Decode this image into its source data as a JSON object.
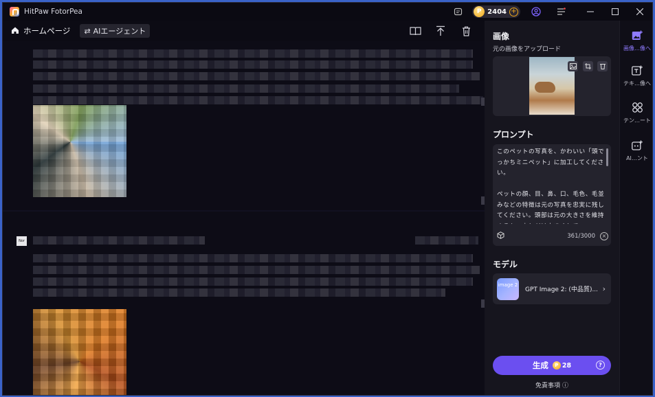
{
  "app": {
    "title": "HitPaw FotorPea",
    "coins": "2404"
  },
  "toolbar": {
    "home_label": "ホームページ",
    "agent_label": "AIエージェント"
  },
  "messages": {
    "second_avatar_text": "Nor"
  },
  "panel": {
    "image_title": "画像",
    "upload_label": "元の画像をアップロード",
    "prompt_title": "プロンプト",
    "prompt_text": "このペットの写真を、かわいい「頭でっかちミニペット」に加工してください。\n\nペットの顔、目、鼻、口、毛色、毛並みなどの特徴は元の写真を忠実に残してください。頭部は元の大きさを維持するか、少しだけ大きくして",
    "char_count": "361/3000",
    "model_title": "モデル",
    "model_thumb_label": "image 2",
    "model_name": "GPT Image 2: (中品質)...",
    "generate_label": "生成",
    "generate_cost": "28",
    "disclaimer": "免責事項"
  },
  "side_nav": [
    {
      "label": "画像…像へ",
      "icon": "image-add-icon",
      "active": true
    },
    {
      "label": "テキ…像へ",
      "icon": "text-to-image-icon",
      "active": false
    },
    {
      "label": "テン…ート",
      "icon": "template-icon",
      "active": false
    },
    {
      "label": "AI…ント",
      "icon": "ai-agent-icon",
      "active": false
    }
  ],
  "colors": {
    "accent": "#6b4ff0",
    "coin": "#f0a818",
    "background": "#0f0e17"
  }
}
